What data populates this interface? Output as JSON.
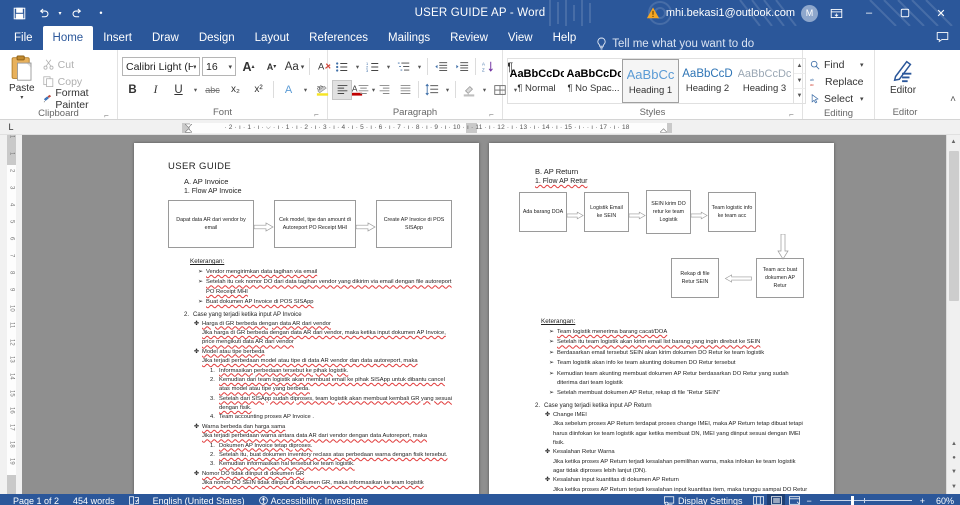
{
  "titlebar": {
    "save_icon": "save-icon",
    "undo_icon": "undo-icon",
    "redo_icon": "redo-icon",
    "customize_icon": "customize-qat-icon",
    "document_title": "USER GUIDE AP  -  Word",
    "warning_icon": "warning-icon",
    "account": "mhi.bekasi1@outlook.com",
    "avatar_initial": "M",
    "ribbon_display_icon": "ribbon-display-options-icon",
    "minimize": "–",
    "restore": "❑",
    "close": "✕"
  },
  "tabs": [
    {
      "label": "File",
      "active": false
    },
    {
      "label": "Home",
      "active": true
    },
    {
      "label": "Insert",
      "active": false
    },
    {
      "label": "Draw",
      "active": false
    },
    {
      "label": "Design",
      "active": false
    },
    {
      "label": "Layout",
      "active": false
    },
    {
      "label": "References",
      "active": false
    },
    {
      "label": "Mailings",
      "active": false
    },
    {
      "label": "Review",
      "active": false
    },
    {
      "label": "View",
      "active": false
    },
    {
      "label": "Help",
      "active": false
    }
  ],
  "tellme": {
    "placeholder": "Tell me what you want to do",
    "icon": "lightbulb-icon"
  },
  "ribbon": {
    "clipboard": {
      "group_label": "Clipboard",
      "paste_label": "Paste",
      "cut_label": "Cut",
      "copy_label": "Copy",
      "format_painter_label": "Format Painter"
    },
    "font": {
      "group_label": "Font",
      "font_name": "Calibri Light (Hea",
      "font_size": "16",
      "grow_label": "A",
      "shrink_label": "A",
      "change_case_label": "Aa",
      "clear_format_label": "A",
      "bold": "B",
      "italic": "I",
      "underline": "U",
      "strikethrough": "abc",
      "subscript": "x₂",
      "superscript": "x²",
      "text_effects": "A",
      "highlight": "ab",
      "font_color": "A"
    },
    "paragraph": {
      "group_label": "Paragraph"
    },
    "styles": {
      "group_label": "Styles",
      "items": [
        {
          "preview": "AaBbCcDc",
          "name": "¶ Normal",
          "selected": false
        },
        {
          "preview": "AaBbCcDc",
          "name": "¶ No Spac...",
          "selected": false
        },
        {
          "preview": "AaBbCc",
          "name": "Heading 1",
          "selected": true
        },
        {
          "preview": "AaBbCcD",
          "name": "Heading 2",
          "selected": false
        },
        {
          "preview": "AaBbCcDc",
          "name": "Heading 3",
          "selected": false
        }
      ]
    },
    "editing": {
      "group_label": "Editing",
      "find_label": "Find",
      "replace_label": "Replace",
      "select_label": "Select"
    },
    "editor": {
      "group_label": "Editor",
      "button_label": "Editor"
    }
  },
  "ruler": {
    "corner_tab": "L",
    "h_ticks": "· 2 · ı · 1 · ı · ⌵ · ı · 1 · ı · 2 · ı · 3 · ı · 4 · ı · 5 · ı · 6 · ı · 7 · ı · 8 · ı · 9 · ı · 10 · ı · 11 · ı · 12 · ı · 13 · ı · 14 · ı · 15 · ı · · ı · 17 · ı · 18",
    "v_nums": [
      "1",
      "",
      "1",
      "2",
      "3",
      "4",
      "5",
      "6",
      "7",
      "8",
      "9",
      "10",
      "11",
      "12",
      "13",
      "14",
      "15",
      "16",
      "17",
      "18",
      "19"
    ]
  },
  "document": {
    "page_left": {
      "title": "USER GUIDE",
      "section_a": "A.   AP Invoice",
      "section_a1": "1.    Flow AP Invoice",
      "flow": [
        "Dapat data AR dari vendor by email",
        "Cek model, tipe dan amount di Autoreport PO Receipt MHI",
        "Create AP Invoice di POS SISApp"
      ],
      "keterangan_label": "Keterangan:",
      "keterangan_items": [
        "Vendor mengirimkan data tagihan via email",
        "Setelah itu cek nomor DO dari data tagihan vendor yang dikirim via email dengan file autoreport PO Receipt MHI",
        "Buat dokumen AP Invoice di POS SISApp"
      ],
      "section_2_num": "2.",
      "section_2": "Case yang terjadi ketika input AP Invoice",
      "cases": [
        {
          "title": "Harga di GR berbeda dengan data AR dari vendor",
          "body": "Jika harga di  GR berbeda dengan data AR dari vendor, maka ketika input dokumen AP Invoice, price mengikuti data AR dari vendor",
          "numbered": []
        },
        {
          "title": "Model atau tipe berbeda",
          "body": "Jika terjadi perbedaan model atau tipe di data AR vendor dan data autoreport, maka",
          "numbered": [
            "Informasikan perbedaan tersebut ke pihak logistik.",
            "Kemudian dari team logistik akan membuat email ke pihak SISApp untuk dibantu cancel atas model atau tipe yang berbeda.",
            "Setelah dari SISApp sudah diproses, team logistik akan membuat kembali GR yang sesuai dengan fisik.",
            "Team accounting proses AP Invoice ."
          ]
        },
        {
          "title": "Warna berbeda dan harga sama",
          "body": "Jika terjadi perbedaan warna antara data AR dari vendor dengan data Autoreport, maka",
          "numbered": [
            "Dokumen AP Invoice tetap diproses.",
            "Setelah itu, buat dokumen inventory reclass atas perbedaan warna dengan fisik tersebut.",
            "Kemudian informasikan hal tersebut ke team logistik."
          ]
        },
        {
          "title": "Nomor DO tidak diinput di dokumen GR",
          "body": "Jika nomor DO SEIN tidak diinput di dokumen GR, maka informasikan ke team logistik",
          "numbered": []
        }
      ]
    },
    "page_right": {
      "section_b": "B.   AP Return",
      "section_b1": "1.    Flow AP Retur",
      "flow_row1": [
        "Ada barang DOA",
        "Logistik Email ke SEIN",
        "SEIN kirim DO retur ke team Logistik",
        "Team logistic info ke team acc"
      ],
      "flow_row2": [
        "Rekap di file Retur SEIN",
        "Team acc buat dokumen AP Retur"
      ],
      "keterangan_label": "Keterangan:",
      "keterangan_items": [
        "Team logistik menerima barang cacat/DOA",
        "Setelah itu team logistik akan kirim email list barang yang ingin direbut ke SEIN",
        "Berdasarkan email tersebut SEIN akan kirim dokumen DO Retur ke team logistik",
        "Team logistik akan info ke team akunting dokumen DO Retur tersebut",
        "Kemudian team akunting membuat dokumen AP Retur berdasarkan DO Retur yang sudah diterima dari team logistik",
        "Setelah membuat dokumen AP Retur, rekap di file “Retur SEIN”"
      ],
      "section_2_num": "2.",
      "section_2": "Case yang terjadi ketika input AP Return",
      "cases": [
        {
          "title": "Change IMEI",
          "body": "Jika sebelum proses AP Return terdapat proses change IMEI,  maka AP Return tetap dibuat tetapi harus diinfokan ke team logistik agar ketika membuat DN, IMEI yang diinput sesuai dengan IMEI fisik."
        },
        {
          "title": "Kesalahan Retur Warna",
          "body": "Jika ketika proses AP Return terjadi kesalahan pemilihan warna, maka infokan ke team logistik agar tidak diproses lebih lanjut (DN)."
        },
        {
          "title": "Kesalahan input kuantitas di dokumen AP Return",
          "body": "Jika ketika proses AP Return terjadi kesalahan input kuantitas item, maka tunggu sampai DO Retur datang dari SEIN setelah itu dapat dilanjutkan prosesnya."
        }
      ]
    }
  },
  "status": {
    "page": "Page 1 of 2",
    "words": "454 words",
    "proofing_icon": "proofing-icon",
    "language": "English (United States)",
    "accessibility_icon": "accessibility-icon",
    "accessibility": "Accessibility: Investigate",
    "display_settings_icon": "display-settings-icon",
    "display_settings": "Display Settings",
    "view_read_icon": "read-mode-icon",
    "view_print_icon": "print-layout-icon",
    "view_web_icon": "web-layout-icon",
    "zoom_out": "−",
    "zoom_in": "+",
    "zoom_level": "60%"
  },
  "colors": {
    "brand": "#2b579a",
    "accent": "#fff",
    "canvas": "#8f8f8f",
    "spellcheck": "#e03a3a"
  }
}
